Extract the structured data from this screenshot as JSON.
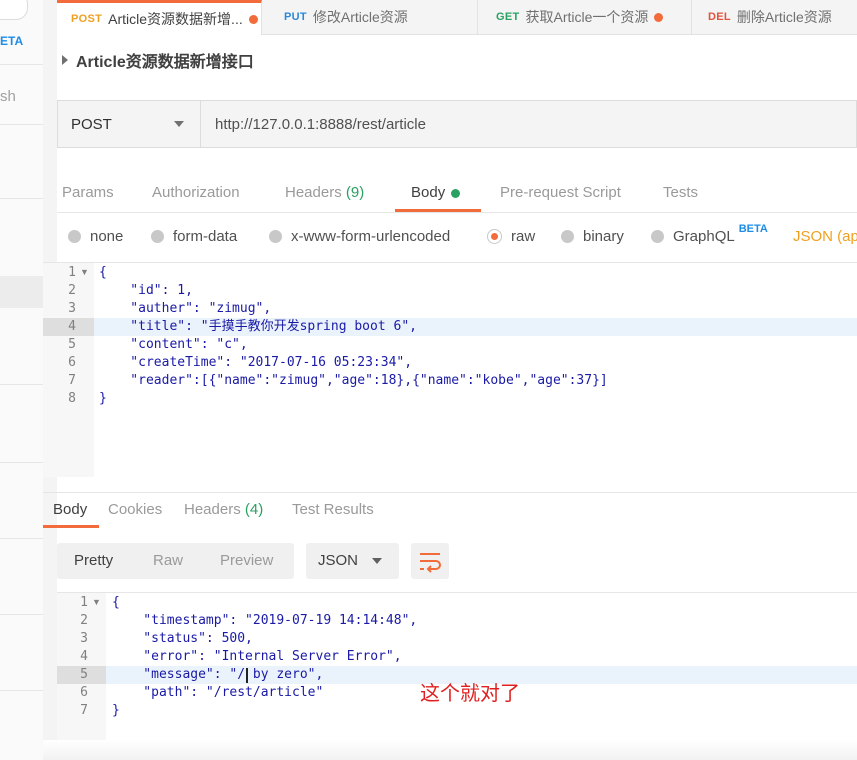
{
  "sidebar": {
    "beta_label": "ETA",
    "search_fragment": "sh"
  },
  "tabs": [
    {
      "method": "POST",
      "label": "Article资源数据新增...",
      "unsaved": true,
      "active": true
    },
    {
      "method": "PUT",
      "label": "修改Article资源",
      "unsaved": false,
      "active": false
    },
    {
      "method": "GET",
      "label": "获取Article一个资源",
      "unsaved": true,
      "active": false
    },
    {
      "method": "DEL",
      "label": "删除Article资源",
      "unsaved": false,
      "active": false
    }
  ],
  "request": {
    "title": "Article资源数据新增接口",
    "method": "POST",
    "url": "http://127.0.0.1:8888/rest/article"
  },
  "request_tabs": {
    "params": "Params",
    "authorization": "Authorization",
    "headers": "Headers",
    "headers_count": "(9)",
    "body": "Body",
    "prerequest": "Pre-request Script",
    "tests": "Tests"
  },
  "body_types": {
    "none": "none",
    "form_data": "form-data",
    "urlencoded": "x-www-form-urlencoded",
    "raw": "raw",
    "binary": "binary",
    "graphql": "GraphQL",
    "graphql_badge": "BETA",
    "content_type": "JSON (app"
  },
  "request_body_lines": [
    "{",
    "    \"id\": 1,",
    "    \"auther\": \"zimug\",",
    "    \"title\": \"手摸手教你开发spring boot 6\",",
    "    \"content\": \"c\",",
    "    \"createTime\": \"2017-07-16 05:23:34\",",
    "    \"reader\":[{\"name\":\"zimug\",\"age\":18},{\"name\":\"kobe\",\"age\":37}]",
    "}"
  ],
  "request_line_numbers": [
    "1",
    "2",
    "3",
    "4",
    "5",
    "6",
    "7",
    "8"
  ],
  "response_tabs": {
    "body": "Body",
    "cookies": "Cookies",
    "headers": "Headers",
    "headers_count": "(4)",
    "test_results": "Test Results"
  },
  "response_view": {
    "pretty": "Pretty",
    "raw": "Raw",
    "preview": "Preview",
    "format": "JSON"
  },
  "response_body_lines": [
    "{",
    "    \"timestamp\": \"2019-07-19 14:14:48\",",
    "    \"status\": 500,",
    "    \"error\": \"Internal Server Error\",",
    "    \"message\": \"/ by zero\",",
    "    \"path\": \"/rest/article\"",
    "}"
  ],
  "response_line_numbers": [
    "1",
    "2",
    "3",
    "4",
    "5",
    "6",
    "7"
  ],
  "annotation": "这个就对了",
  "colors": {
    "accent": "#f26b3a",
    "green": "#2aa163",
    "beta_blue": "#1f8ce6",
    "annotation_red": "#e02020"
  }
}
